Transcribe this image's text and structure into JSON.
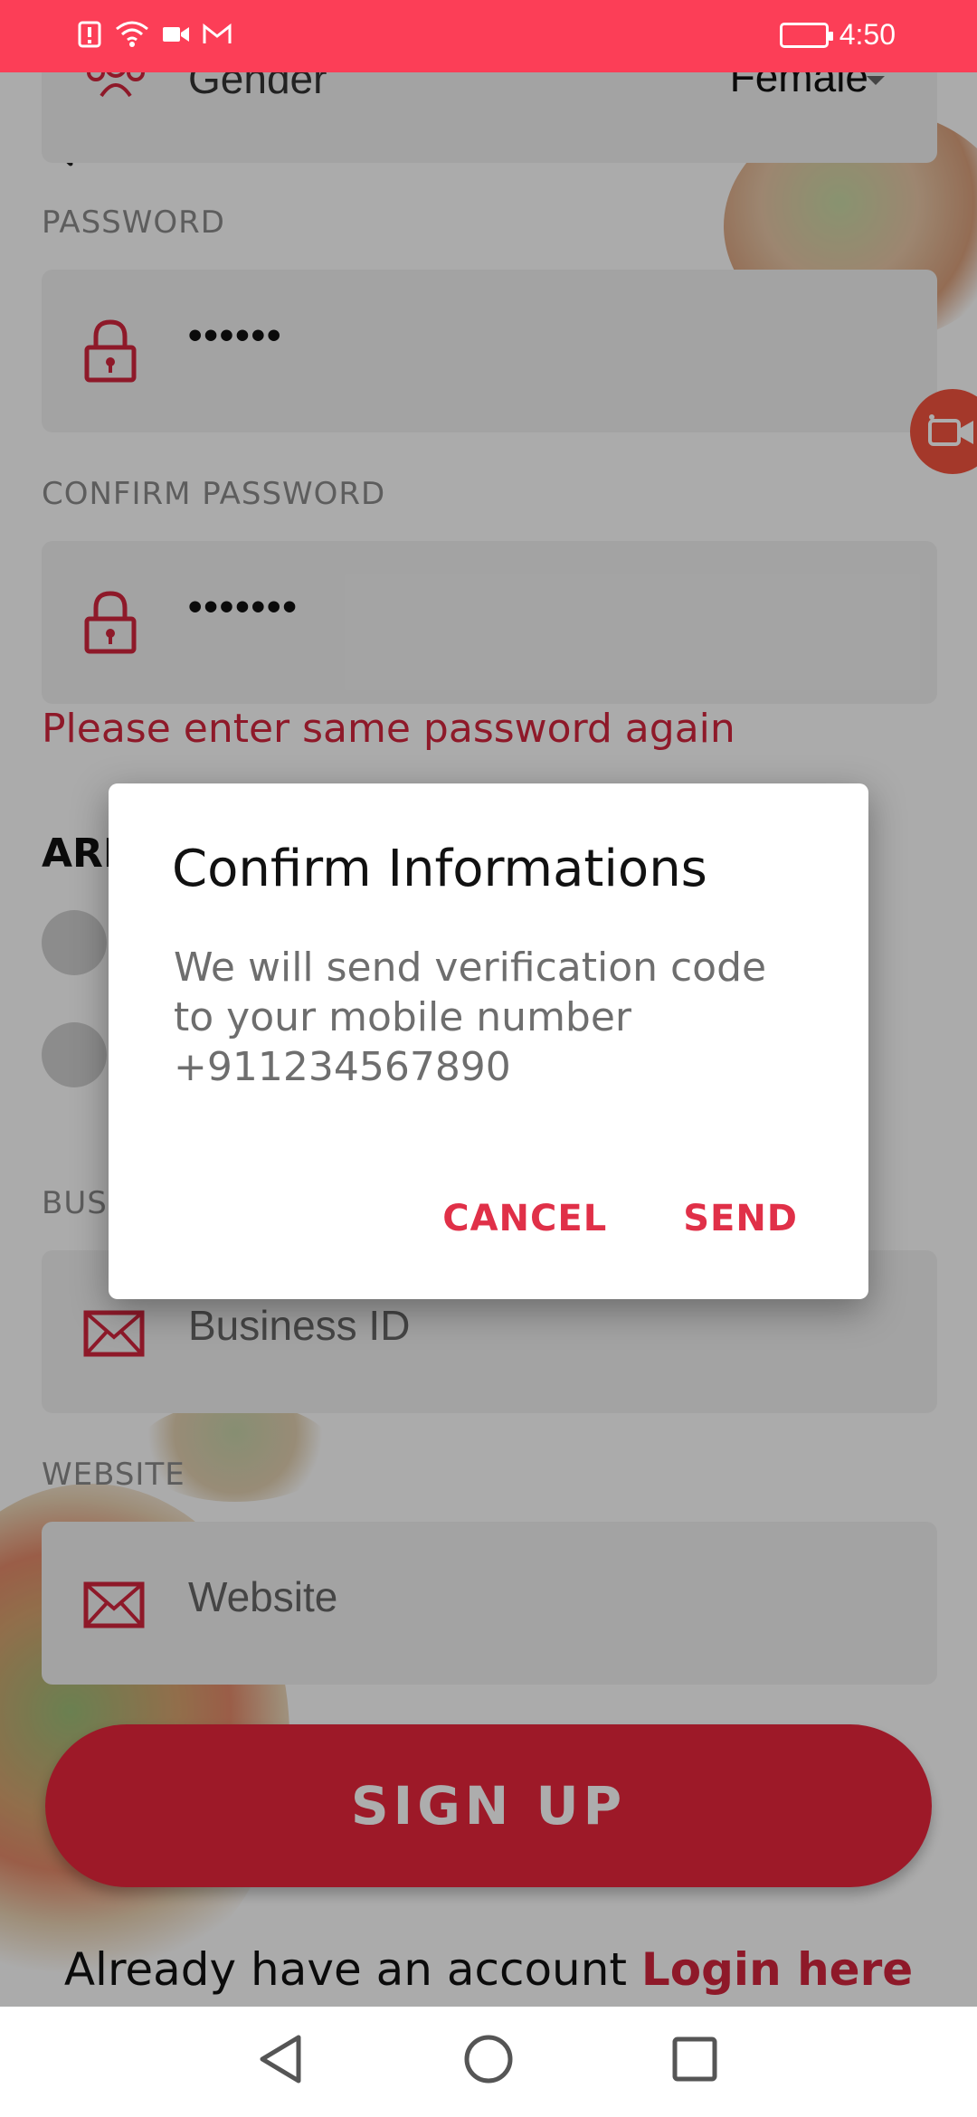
{
  "status_bar": {
    "time": "4:50",
    "icons": [
      "alert-icon",
      "wifi-icon",
      "video-icon",
      "gmail-icon",
      "battery-charging-icon"
    ]
  },
  "form": {
    "gender": {
      "label": "Gender",
      "value": "Female"
    },
    "password": {
      "label": "PASSWORD",
      "value": "••••••"
    },
    "confirm_password": {
      "label": "CONFIRM PASSWORD",
      "value": "•••••••"
    },
    "error": "Please enter same password again",
    "section_heading": "ARI",
    "business_id": {
      "label": "BUS",
      "placeholder": "Business ID"
    },
    "website": {
      "label": "WEBSITE",
      "placeholder": "Website"
    },
    "signup_button": "SIGN UP",
    "login_prompt": "Already have an account",
    "login_link": "Login here"
  },
  "dialog": {
    "title": "Confirm Informations",
    "message": "We will send verification code to your mobile number +911234567890",
    "cancel": "CANCEL",
    "send": "SEND"
  },
  "colors": {
    "accent": "#fc3e57",
    "brand_red": "#e8263c",
    "error": "#d2253d"
  }
}
